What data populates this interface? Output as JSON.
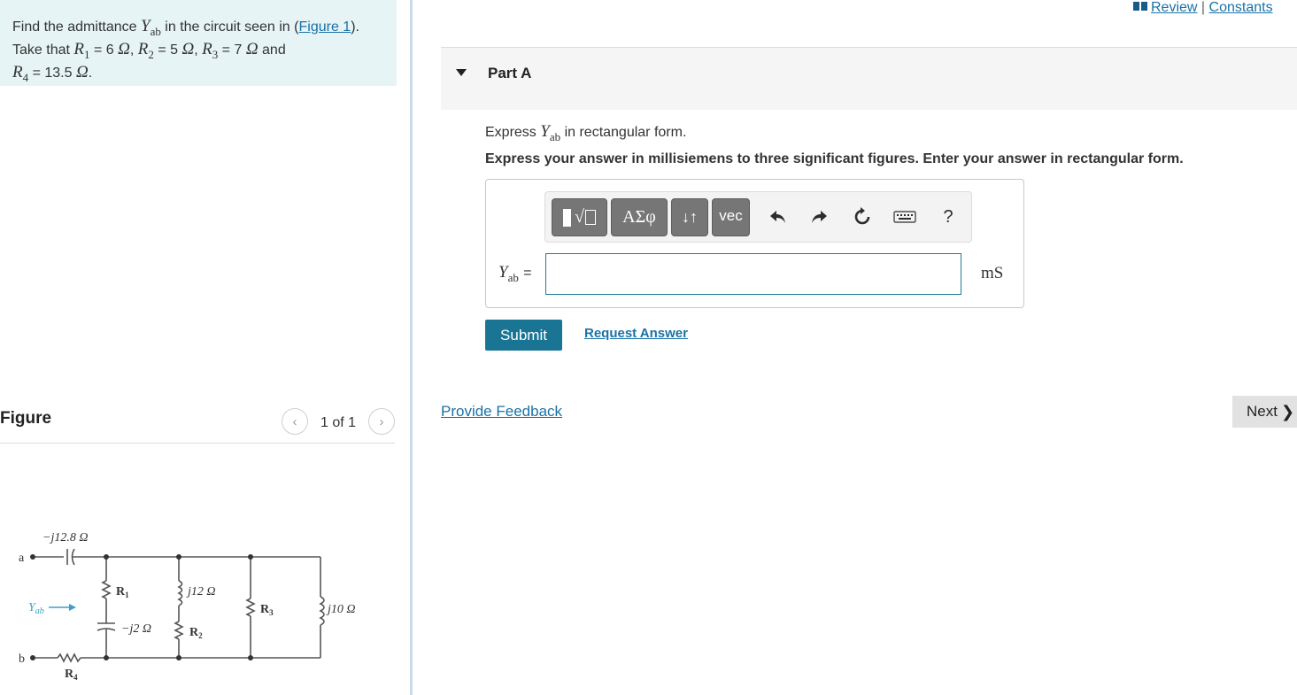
{
  "problem": {
    "intro": "Find the admittance",
    "intro_after": "in the circuit seen in (",
    "figure_link": "Figure 1",
    "intro_close": ").",
    "line2_prefix": "Take that",
    "y_symbol": "Y",
    "y_sub": "ab",
    "r1_sym": "R",
    "r1_sub": "1",
    "r1_val": "= 6",
    "r2_sym": "R",
    "r2_sub": "2",
    "r2_val": "= 5",
    "r3_sym": "R",
    "r3_sub": "3",
    "r3_val": "= 7",
    "r4_sym": "R",
    "r4_sub": "4",
    "r4_val": "= 13.5",
    "ohm": "Ω",
    "and": "and",
    "comma": ","
  },
  "figure": {
    "title": "Figure",
    "counter": "1 of 1",
    "prev_icon": "chevron-left-icon",
    "next_icon": "chevron-right-icon",
    "labels": {
      "cap_top": "−j12.8 Ω",
      "node_a": "a",
      "node_b": "b",
      "yab": "Y",
      "yab_sub": "ab",
      "r1": "R",
      "r1_sub": "1",
      "r2": "R",
      "r2_sub": "2",
      "r3": "R",
      "r3_sub": "3",
      "r4": "R",
      "r4_sub": "4",
      "ind1": "j12 Ω",
      "cap2": "−j2 Ω",
      "ind2": "j10 Ω"
    }
  },
  "header": {
    "review": "Review",
    "separator": "|",
    "constants": "Constants",
    "book_icon": "book-icon"
  },
  "part": {
    "title": "Part A",
    "caret_icon": "caret-down-icon",
    "instruction_prefix": "Express",
    "instruction_suffix": "in rectangular form.",
    "instruction_bold": "Express your answer in millisiemens to three significant figures. Enter your answer in rectangular form."
  },
  "toolbar": {
    "template_label": "▮√▯",
    "greek_label": "ΑΣφ",
    "arrows_label": "↓↑",
    "vec_label": "vec",
    "undo_icon": "undo-icon",
    "redo_icon": "redo-icon",
    "reset_icon": "reset-icon",
    "keyboard_icon": "keyboard-icon",
    "help_label": "?"
  },
  "answer": {
    "label_sym": "Y",
    "label_sub": "ab",
    "label_eq": "=",
    "value": "",
    "unit": "mS"
  },
  "actions": {
    "submit": "Submit",
    "request_answer": "Request Answer",
    "provide_feedback": "Provide Feedback",
    "next": "Next",
    "next_glyph": "❯"
  },
  "colors": {
    "accent": "#1a7595",
    "link": "#1a72a6",
    "problem_bg": "#e6f4f6"
  }
}
